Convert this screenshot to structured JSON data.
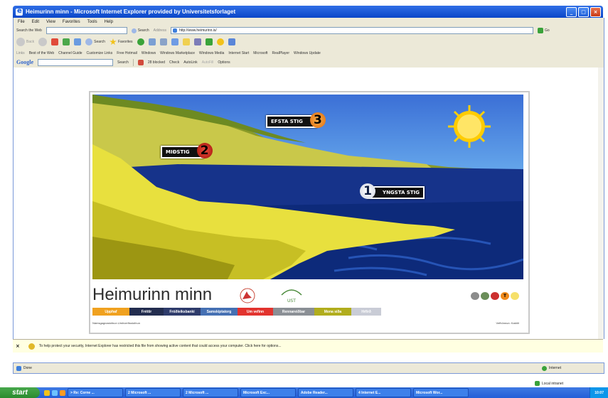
{
  "window": {
    "title": "Heimurinn minn - Microsoft Internet Explorer provided by Universitetsforlaget",
    "minimize": "_",
    "maximize": "□",
    "close": "×"
  },
  "menu": [
    "File",
    "Edit",
    "View",
    "Favorites",
    "Tools",
    "Help"
  ],
  "toolbar": {
    "search_web_label": "Search the Web",
    "search_label": "Search",
    "back": "Back",
    "search": "Search",
    "favorites": "Favorites",
    "address_label": "Address",
    "address_value": "http://www.heimurinn.is/",
    "go": "Go"
  },
  "links": [
    "Links",
    "Best of the Web",
    "Channel Guide",
    "Customize Links",
    "Free Hotmail",
    "Windows",
    "Windows Marketplace",
    "Windows Media",
    "Internet Start",
    "Microsoft",
    "RealPlayer",
    "Windows Update"
  ],
  "google_bar": {
    "brand": "Google",
    "search": "Search",
    "blocked": "28 blocked",
    "check": "Check",
    "autolink": "AutoLink",
    "autofill": "AutoFill",
    "options": "Options"
  },
  "site": {
    "levels": [
      {
        "label": "EFSTA STIG",
        "number": "3"
      },
      {
        "label": "MIÐSTIG",
        "number": "2"
      },
      {
        "label": "YNGSTA STIG",
        "number": "1"
      }
    ],
    "brand": "Heimurinn minn",
    "logo2_text": "UST",
    "nav": [
      {
        "label": "Upphaf",
        "color": "#f0a11f"
      },
      {
        "label": "Fréttir",
        "color": "#232d4f"
      },
      {
        "label": "Fróðleiksbanki",
        "color": "#2e3b6b"
      },
      {
        "label": "Samskiptatorg",
        "color": "#4570b3"
      },
      {
        "label": "Um vefinn",
        "color": "#e2332e"
      },
      {
        "label": "Rennareiðbar",
        "color": "#8a8f95"
      },
      {
        "label": "Mona síða",
        "color": "#b1ad1d"
      },
      {
        "label": "Hrfirð",
        "color": "#c9ccd6"
      }
    ],
    "footer_left": "Námsgagnastofnun  Umhverfisstofnun",
    "footer_right": "Vefhönnun: Kaktið",
    "controls": [
      "",
      "",
      "",
      "T",
      ""
    ],
    "control_colors": [
      "#8c8c8c",
      "#6b8e5a",
      "#cc2f2f",
      "#f08a1a",
      "#f6e06a"
    ]
  },
  "infobar_text": "To help protect your security, Internet Explorer has restricted this file from showing active content that could access your computer. Click here for options...",
  "status": {
    "left": "Done",
    "zone": "Internet",
    "local": "Local intranet"
  },
  "taskbar": {
    "start": "start",
    "tasks": [
      "> Re: Corne ...",
      "2 Microsoft ...",
      "2 Microsoft ...",
      "Microsoft Exc...",
      "Adobe Reader...",
      "4 Internet E...",
      "Microsoft Wor..."
    ],
    "clock": "10:07"
  }
}
